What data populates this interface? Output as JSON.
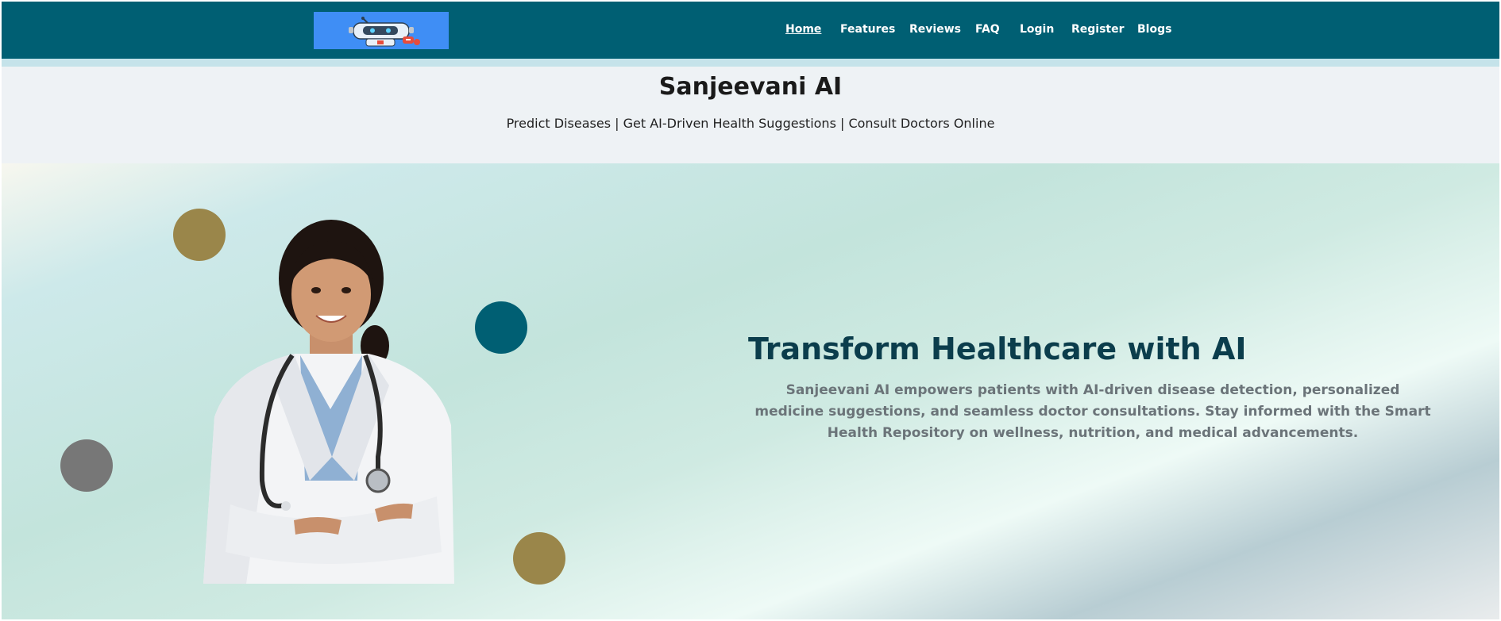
{
  "nav": {
    "items": [
      {
        "label": "Home",
        "active": true
      },
      {
        "label": "Features"
      },
      {
        "label": "Reviews"
      },
      {
        "label": "FAQ"
      },
      {
        "label": "Login"
      },
      {
        "label": "Register"
      },
      {
        "label": "Blogs"
      }
    ]
  },
  "header": {
    "title": "Sanjeevani AI",
    "tagline": "Predict Diseases | Get AI-Driven Health Suggestions | Consult Doctors Online"
  },
  "hero": {
    "title": "Transform Healthcare with AI",
    "description": "Sanjeevani AI empowers patients with AI-driven disease detection, personalized medicine suggestions, and seamless doctor consultations. Stay informed with the Smart Health Repository on wellness, nutrition, and medical advancements."
  },
  "colors": {
    "nav_bg": "#005f73",
    "accent_teal": "#005f73",
    "accent_gold": "#9a864a",
    "accent_gray": "#777777",
    "hero_title": "#0b3d4c"
  },
  "icons": {
    "logo": "robot-logo-icon"
  }
}
